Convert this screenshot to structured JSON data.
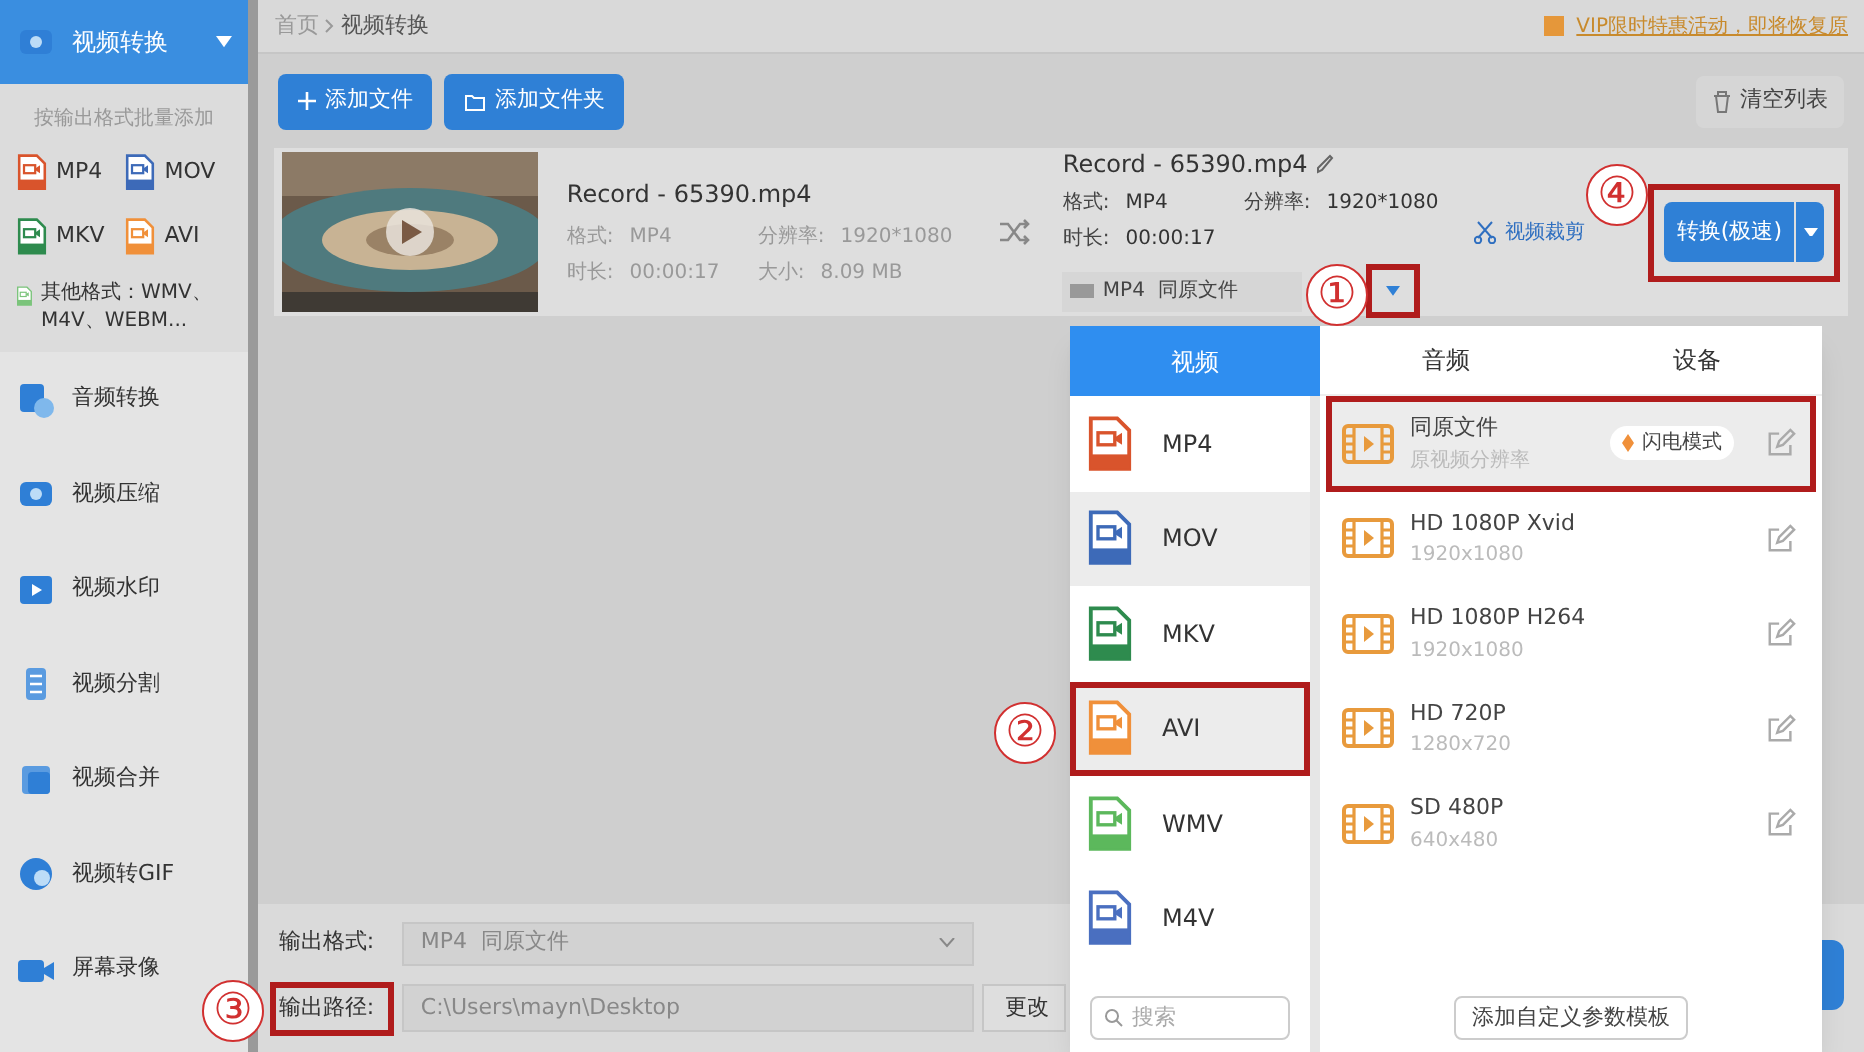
{
  "sidebar": {
    "top_item": {
      "label": "视频转换",
      "expanded": true
    },
    "hint": "按输出格式批量添加",
    "formats": [
      {
        "label": "MP4",
        "color": "#d9542c"
      },
      {
        "label": "MOV",
        "color": "#3d6ab8"
      },
      {
        "label": "MKV",
        "color": "#2e8b4e"
      },
      {
        "label": "AVI",
        "color": "#f0903a"
      }
    ],
    "other_formats": "其他格式：WMV、M4V、WEBM...",
    "items": [
      {
        "label": "音频转换"
      },
      {
        "label": "视频压缩"
      },
      {
        "label": "视频水印"
      },
      {
        "label": "视频分割"
      },
      {
        "label": "视频合并"
      },
      {
        "label": "视频转GIF"
      },
      {
        "label": "屏幕录像"
      }
    ]
  },
  "breadcrumb": [
    "首页",
    "视频转换"
  ],
  "promo": "VIP限时特惠活动，即将恢复原",
  "toolbar": {
    "add_file": "添加文件",
    "add_folder": "添加文件夹",
    "clear": "清空列表"
  },
  "file": {
    "source": {
      "name": "Record - 65390.mp4",
      "fields": [
        {
          "label": "格式:",
          "value": "MP4"
        },
        {
          "label": "分辨率:",
          "value": "1920*1080"
        },
        {
          "label": "时长:",
          "value": "00:00:17"
        },
        {
          "label": "大小:",
          "value": "8.09 MB"
        }
      ]
    },
    "target": {
      "name": "Record - 65390.mp4",
      "fields": [
        {
          "label": "格式:",
          "value": "MP4"
        },
        {
          "label": "分辨率:",
          "value": "1920*1080"
        },
        {
          "label": "时长:",
          "value": "00:00:17"
        }
      ]
    },
    "format_select": "MP4  同原文件",
    "dropdown_outlined": true,
    "trim": "视频裁剪",
    "convert": "转换(极速)",
    "convert_outlined": true
  },
  "output": {
    "format_label": "输出格式:",
    "format_value": "MP4  同原文件",
    "path_label": "输出路径:",
    "path_outlined": true,
    "path_value": "C:\\Users\\mayn\\Desktop",
    "change": "更改"
  },
  "dropdown": {
    "tabs": [
      {
        "label": "视频",
        "selected": true
      },
      {
        "label": "音频",
        "selected": false
      },
      {
        "label": "设备",
        "selected": false
      }
    ],
    "formats": [
      {
        "label": "MP4",
        "color": "#d9542c",
        "shaded": false,
        "outlined": false
      },
      {
        "label": "MOV",
        "color": "#3d6ab8",
        "shaded": true,
        "outlined": false
      },
      {
        "label": "MKV",
        "color": "#2e8b4e",
        "shaded": false,
        "outlined": false
      },
      {
        "label": "AVI",
        "color": "#f0903a",
        "shaded": true,
        "outlined": true
      },
      {
        "label": "WMV",
        "color": "#5cb85c",
        "shaded": false,
        "outlined": false
      },
      {
        "label": "M4V",
        "color": "#4a6fc0",
        "shaded": false,
        "outlined": false
      }
    ],
    "presets": [
      {
        "title": "同原文件",
        "subtitle": "原视频分辨率",
        "badge": "闪电模式",
        "shaded": true,
        "outlined": true
      },
      {
        "title": "HD 1080P Xvid",
        "subtitle": "1920x1080",
        "shaded": false,
        "outlined": false
      },
      {
        "title": "HD 1080P H264",
        "subtitle": "1920x1080",
        "shaded": false,
        "outlined": false
      },
      {
        "title": "HD 720P",
        "subtitle": "1280x720",
        "shaded": false,
        "outlined": false
      },
      {
        "title": "SD 480P",
        "subtitle": "640x480",
        "shaded": false,
        "outlined": false
      }
    ],
    "search_placeholder": "搜索",
    "add_template": "添加自定义参数模板"
  },
  "annotations": [
    "①",
    "②",
    "③",
    "④"
  ]
}
